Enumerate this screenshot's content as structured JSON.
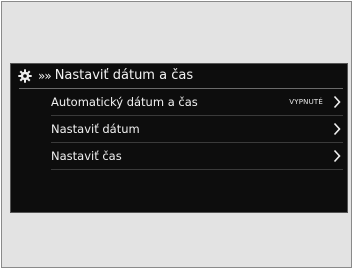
{
  "header": {
    "breadcrumb_arrows": "»»",
    "title": "Nastaviť dátum a čas",
    "icon": "gear-icon"
  },
  "menu": {
    "items": [
      {
        "label": "Automatický dátum a čas",
        "value": "VYPNUTÉ",
        "icon": "chevron-right-icon"
      },
      {
        "label": "Nastaviť dátum",
        "value": "",
        "icon": "chevron-right-icon"
      },
      {
        "label": "Nastaviť čas",
        "value": "",
        "icon": "chevron-right-icon"
      }
    ]
  },
  "colors": {
    "screen_bg": "#0d0d0d",
    "frame_bg": "#e3e3e3",
    "text": "#f0f0f0"
  }
}
